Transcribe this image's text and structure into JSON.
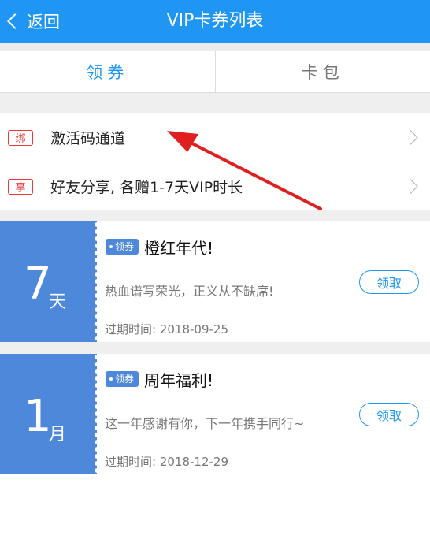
{
  "header": {
    "back_label": "返回",
    "title": "VIP卡券列表"
  },
  "tabs": [
    {
      "label": "领券"
    },
    {
      "label": "卡包"
    }
  ],
  "menu": [
    {
      "tag": "绑",
      "label": "激活码通道"
    },
    {
      "tag": "享",
      "label": "好友分享, 各赠1-7天VIP时长"
    }
  ],
  "coupons": [
    {
      "value": "7",
      "unit": "天",
      "badge": "领券",
      "title": "橙红年代!",
      "desc": "热血谱写荣光，正义从不缺席!",
      "expiry": "过期时间: 2018-09-25",
      "button": "领取"
    },
    {
      "value": "1",
      "unit": "月",
      "badge": "领券",
      "title": "周年福利!",
      "desc": "这一年感谢有你，下一年携手同行~",
      "expiry": "过期时间: 2018-12-29",
      "button": "领取"
    }
  ],
  "colors": {
    "primary": "#1f96f3",
    "stub": "#4e88da",
    "tag_red": "#e83a3a",
    "arrow": "#e02020"
  }
}
